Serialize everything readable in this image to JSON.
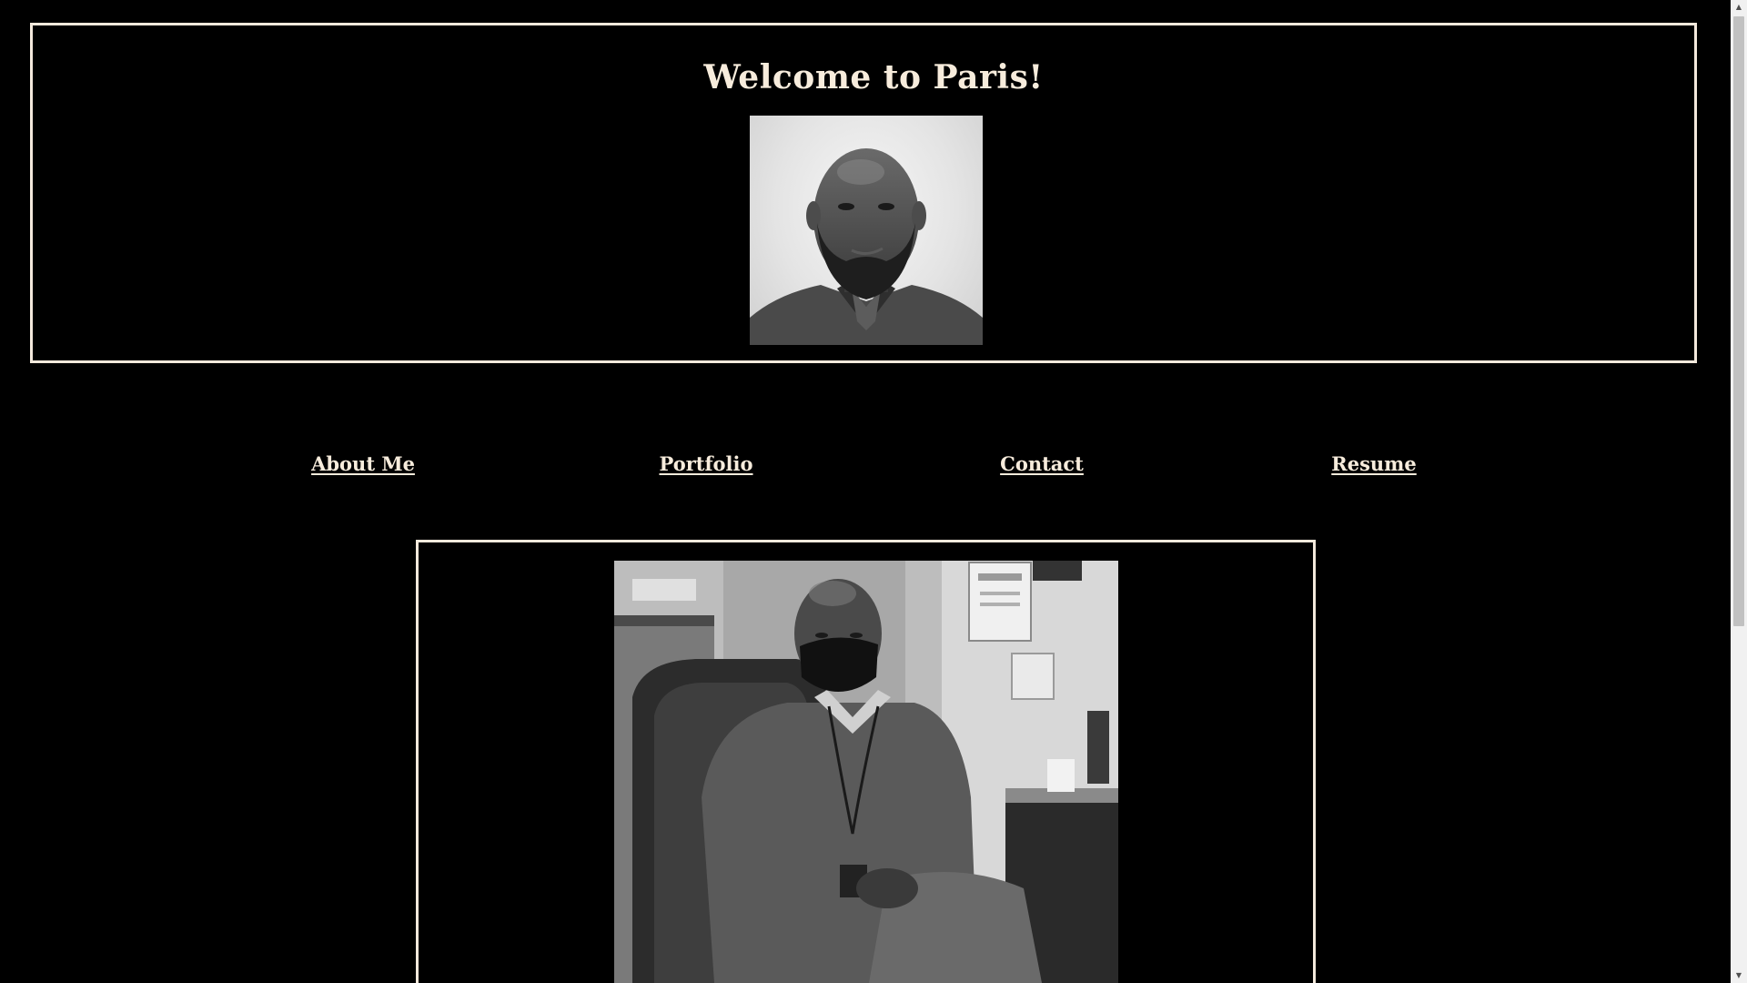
{
  "header": {
    "title": "Welcome to Paris!",
    "portrait_alt": "headshot-portrait"
  },
  "nav": {
    "items": [
      {
        "label": "About Me"
      },
      {
        "label": "Portfolio"
      },
      {
        "label": "Contact"
      },
      {
        "label": "Resume"
      }
    ]
  },
  "main": {
    "photo_alt": "office-photo"
  },
  "colors": {
    "background": "#000000",
    "accent": "#f7ecdc",
    "border": "#f3e9dc"
  },
  "icons": {
    "scroll_up": "scroll-up-arrow-icon",
    "scroll_down": "scroll-down-arrow-icon"
  }
}
